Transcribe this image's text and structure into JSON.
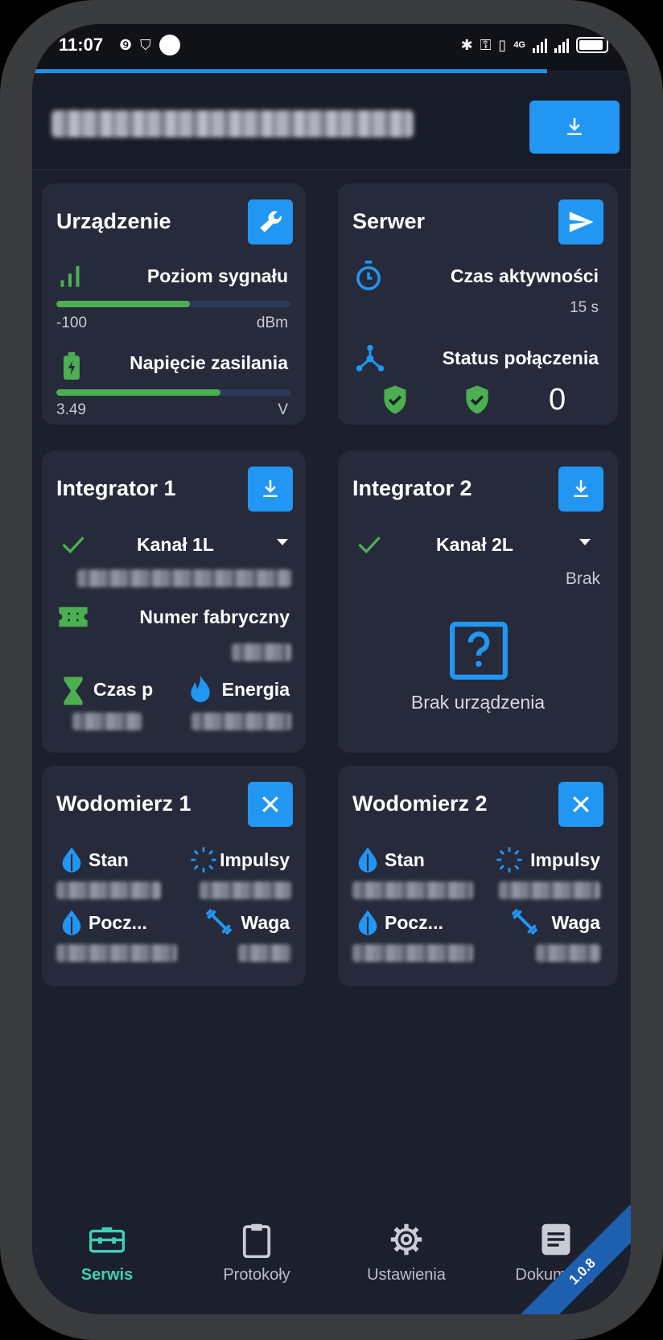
{
  "status_bar": {
    "time": "11:07",
    "network": "4G"
  },
  "header": {
    "progress_fraction": 0.86
  },
  "cards": {
    "device": {
      "title": "Urządzenie",
      "signal": {
        "label": "Poziom sygnału",
        "value": "-100",
        "unit": "dBm",
        "level": 0.57
      },
      "voltage": {
        "label": "Napięcie zasilania",
        "value": "3.49",
        "unit": "V",
        "level": 0.7
      }
    },
    "server": {
      "title": "Serwer",
      "uptime": {
        "label": "Czas aktywności",
        "value": "15 s"
      },
      "connection": {
        "label": "Status połączenia",
        "count": "0"
      }
    },
    "integrator1": {
      "title": "Integrator 1",
      "channel": "Kanał 1L",
      "serial_label": "Numer fabryczny",
      "time_label": "Czas p",
      "energy_label": "Energia"
    },
    "integrator2": {
      "title": "Integrator 2",
      "channel": "Kanał 2L",
      "none_value": "Brak",
      "no_device": "Brak urządzenia"
    },
    "watermeter1": {
      "title": "Wodomierz 1",
      "state": "Stan",
      "impulses": "Impulsy",
      "start": "Pocz...",
      "weight": "Waga"
    },
    "watermeter2": {
      "title": "Wodomierz 2",
      "state": "Stan",
      "impulses": "Impulsy",
      "start": "Pocz...",
      "weight": "Waga"
    }
  },
  "nav": {
    "items": [
      {
        "label": "Serwis",
        "icon": "toolbox-icon",
        "active": true
      },
      {
        "label": "Protokoły",
        "icon": "clipboard-icon"
      },
      {
        "label": "Ustawienia",
        "icon": "gear-icon"
      },
      {
        "label": "Dokumenty",
        "icon": "document-icon"
      }
    ]
  },
  "version": "1.0.8",
  "colors": {
    "accent": "#2196f3",
    "bg": "#1c1f2e",
    "card": "#262a3a",
    "green": "#4caf50",
    "active_nav": "#3fd1b9"
  }
}
